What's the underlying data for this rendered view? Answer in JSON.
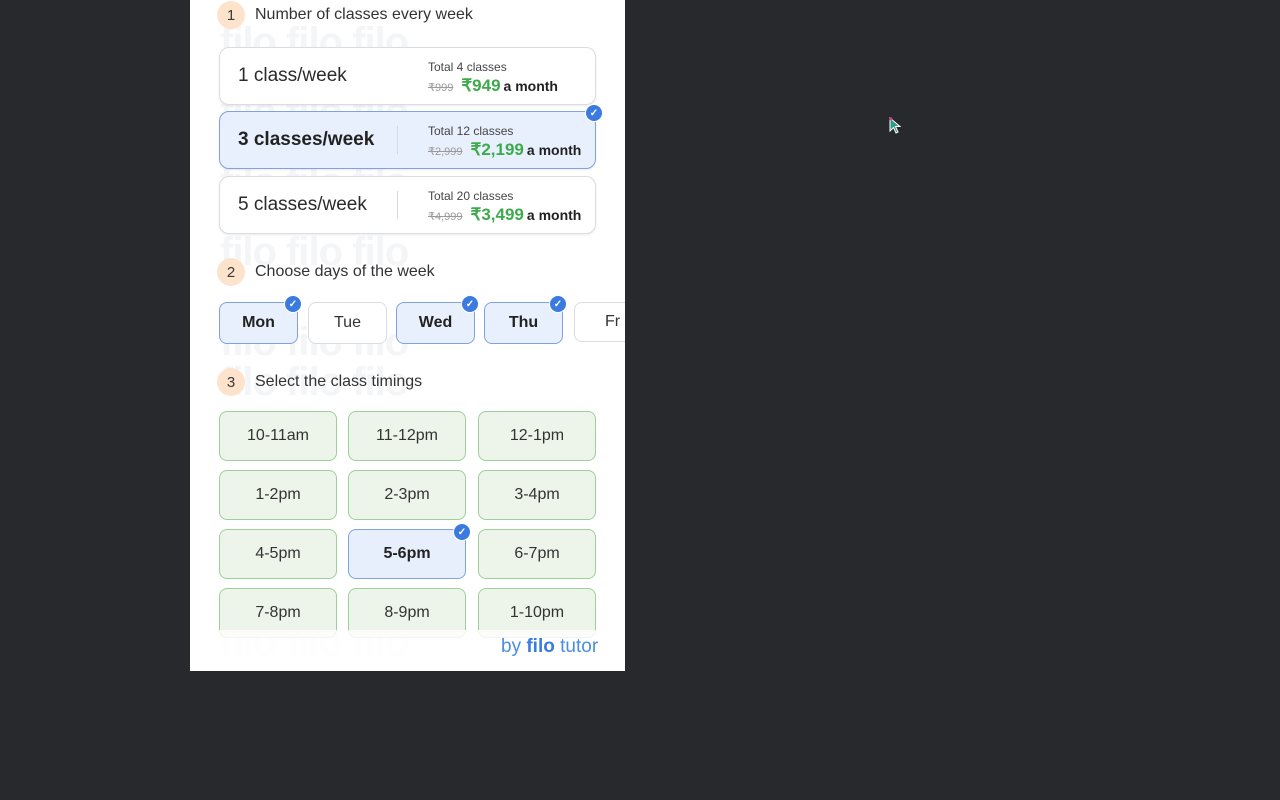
{
  "steps": [
    {
      "num": "1",
      "title": "Number of classes every week"
    },
    {
      "num": "2",
      "title": "Choose days of the week"
    },
    {
      "num": "3",
      "title": "Select the class timings"
    }
  ],
  "plans": [
    {
      "name": "1 class/week",
      "total": "Total 4 classes",
      "old_price": "₹999",
      "new_price": "₹949",
      "per": "a month",
      "selected": false
    },
    {
      "name": "3 classes/week",
      "total": "Total 12 classes",
      "old_price": "₹2,999",
      "new_price": "₹2,199",
      "per": "a month",
      "selected": true
    },
    {
      "name": "5 classes/week",
      "total": "Total 20 classes",
      "old_price": "₹4,999",
      "new_price": "₹3,499",
      "per": "a month",
      "selected": false
    }
  ],
  "days": [
    {
      "label": "Mon",
      "selected": true
    },
    {
      "label": "Tue",
      "selected": false
    },
    {
      "label": "Wed",
      "selected": true
    },
    {
      "label": "Thu",
      "selected": true
    },
    {
      "label": "Fr",
      "selected": false
    }
  ],
  "timings": [
    [
      "10-11am",
      "11-12pm",
      "12-1pm"
    ],
    [
      "1-2pm",
      "2-3pm",
      "3-4pm"
    ],
    [
      "4-5pm",
      "5-6pm",
      "6-7pm"
    ],
    [
      "7-8pm",
      "8-9pm",
      "1-10pm"
    ]
  ],
  "selected_timing": "5-6pm",
  "check_glyph": "✓",
  "brand": {
    "by": "by",
    "filo": "filo",
    "tutor": "tutor"
  },
  "watermark": "filo filo filo",
  "colors": {
    "accent": "#3b7be0",
    "price_green": "#3daa4c",
    "slot_green": "#edf5ea",
    "selected_blue": "#e9f0fd"
  }
}
